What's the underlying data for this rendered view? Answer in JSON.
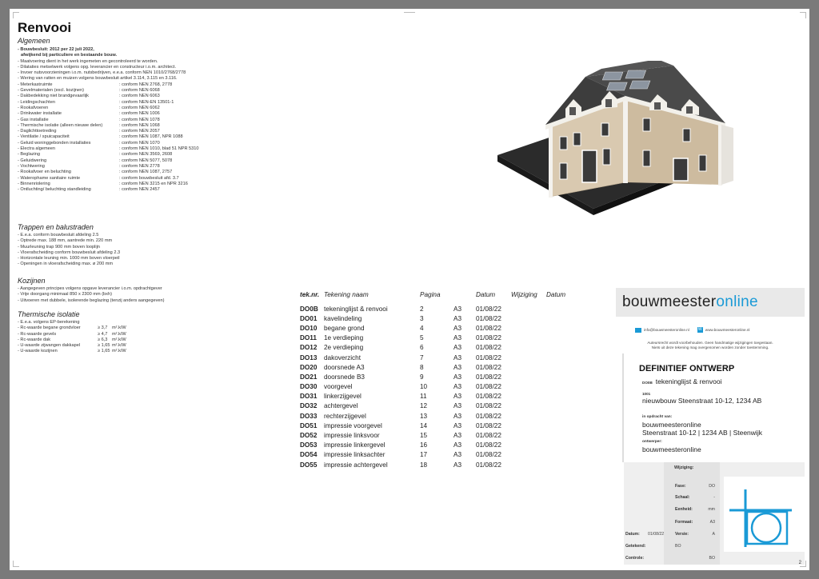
{
  "title": "Renvooi",
  "sections": {
    "algemeen": {
      "heading": "Algemeen",
      "bold_lines": [
        "- Bouwbesluit: 2012 per 22 juli 2022,",
        "afwijkend bij particuliere en bestaande bouw."
      ],
      "lines": [
        "- Maatvoering dient in het werk ingemeten en gecontroleerd te worden.",
        "- Dilataties metselwerk volgens opg. leverancier en constructeur i.o.m. architect.",
        "- Invoer nutsvoorzieningen i.o.m. nutsbedrijven, e.e.a. conform NEN 1010/2768/2778",
        "- Wering van ratten en muizen volgens bouwbesluit artikel 3.114, 3.115 en 3.116."
      ],
      "pairs": [
        [
          "- Meterkastruimte",
          ": conform NEN 2768, 2778"
        ],
        [
          "- Gevelmaterialen (excl. kozijnen)",
          ": conform NEN 6068"
        ],
        [
          "- Dakbedekking niet brandgevaarlijk",
          ": conform NEN 6063"
        ],
        [
          "- Leidingschachten",
          ": conform NEN-EN 13501-1"
        ],
        [
          "- Rookafvoeren",
          ": conform NEN 6062"
        ],
        [
          "- Drinkwater installatie",
          ": conform NEN 1006"
        ],
        [
          "- Gas installatie",
          ": conform NEN 1078"
        ],
        [
          "- Thermische isolatie (alleen nieuwe delen)",
          ": conform NEN 1068"
        ],
        [
          "- Daglichttoetreding",
          ": conform NEN 2057"
        ],
        [
          "- Ventilatie / spuicapaciteit",
          ": conform NEN 1087, NPR 1088"
        ],
        [
          "- Geluid woninggebonden installaties",
          ": conform NEN 1070"
        ],
        [
          "- Electra algemeen",
          ": conform NEN 1010, blad 51 NPR 5310"
        ],
        [
          "- Beglazing",
          ": conform NEN 3569, 2608"
        ],
        [
          "- Geluidwering",
          ": conform NEN 5077, 5078"
        ],
        [
          "- Vochtwering",
          ": conform NEN 2778"
        ],
        [
          "- Rookafvoer en beluchting",
          ": conform NEN 1087, 2757"
        ],
        [
          "- Waterophame sanitaire ruimte",
          ": conform bouwbesluit afd. 3.7"
        ],
        [
          "- Binnenriolering",
          ": conform NEN 3215 en NPR 3216"
        ],
        [
          "- Ontluchting/ beluchting standleiding",
          ": conform NEN 2457"
        ]
      ]
    },
    "trappen": {
      "heading": "Trappen en balustraden",
      "lines": [
        "- E.e.a. conform bouwbesluit afdeling 2.5",
        "- Optrede max. 188 mm, aantrede min. 220 mm",
        "- Muurleuning trap 900 mm boven looplijn",
        "- Vloerafscheiding conform bouwbesluit afdeling 2.3",
        "- Horizontale leuning min. 1000 mm boven vloerpeil",
        "- Openingen in vloerafscheiding max. ø 200 mm"
      ]
    },
    "kozijnen": {
      "heading": "Kozijnen",
      "lines": [
        "- Aangegeven principes volgens opgave leverancier i.o.m. opdrachtgever",
        "- Vrije doorgang minimaal 850 x 2300 mm (bxh)",
        "- Uitvoeren met dubbele, isolerende beglazing (tenzij anders aangegeven)"
      ]
    },
    "isolatie": {
      "heading": "Thermische isolatie",
      "line": "- E.e.a. volgens EP-berekening",
      "rows": [
        [
          "- Rc-waarde begane grondvloer",
          "≥ 3,7",
          "m².k/W"
        ],
        [
          "- Rc-waarde gevels",
          "≥ 4,7",
          "m².k/W"
        ],
        [
          "- Rc-waarde dak",
          "≥ 6,3",
          "m².k/W"
        ],
        [
          "- U-waarde zijwangen dakkapel",
          "≥ 1,65",
          "m².k/W"
        ],
        [
          "- U-waarde kozijnen",
          "≥ 1,65",
          "m².k/W"
        ]
      ]
    }
  },
  "drawing_list": {
    "headers": [
      "tek.nr.",
      "Tekening naam",
      "Pagina",
      "Datum",
      "Wijziging",
      "Datum"
    ],
    "rows": [
      [
        "DO0B",
        "tekeninglijst & renvooi",
        "2",
        "A3",
        "01/08/22"
      ],
      [
        "DO01",
        "kavelindeling",
        "3",
        "A3",
        "01/08/22"
      ],
      [
        "DO10",
        "begane grond",
        "4",
        "A3",
        "01/08/22"
      ],
      [
        "DO11",
        "1e verdieping",
        "5",
        "A3",
        "01/08/22"
      ],
      [
        "DO12",
        "2e verdieping",
        "6",
        "A3",
        "01/08/22"
      ],
      [
        "DO13",
        "dakoverzicht",
        "7",
        "A3",
        "01/08/22"
      ],
      [
        "DO20",
        "doorsnede A3",
        "8",
        "A3",
        "01/08/22"
      ],
      [
        "DO21",
        "doorsnede B3",
        "9",
        "A3",
        "01/08/22"
      ],
      [
        "DO30",
        "voorgevel",
        "10",
        "A3",
        "01/08/22"
      ],
      [
        "DO31",
        "linkerzijgevel",
        "11",
        "A3",
        "01/08/22"
      ],
      [
        "DO32",
        "achtergevel",
        "12",
        "A3",
        "01/08/22"
      ],
      [
        "DO33",
        "rechterzijgevel",
        "13",
        "A3",
        "01/08/22"
      ],
      [
        "DO51",
        "impressie voorgevel",
        "14",
        "A3",
        "01/08/22"
      ],
      [
        "DO52",
        "impressie linksvoor",
        "15",
        "A3",
        "01/08/22"
      ],
      [
        "DO53",
        "impressie linkergevel",
        "16",
        "A3",
        "01/08/22"
      ],
      [
        "DO54",
        "impressie linksachter",
        "17",
        "A3",
        "01/08/22"
      ],
      [
        "DO55",
        "impressie achtergevel",
        "18",
        "A3",
        "01/08/22"
      ]
    ]
  },
  "titleblock": {
    "brand_part1": "bouwmeester",
    "brand_part2": "online",
    "email": "info@bouwmeesteronline.nl",
    "website": "www.bouwmeesteronline.nl",
    "copyright_1": "Auteursrecht wordt voorbehouden. Geen handmatige wijzigingen toegestaan.",
    "copyright_2": "Niets uit deze tekening mag overgenomen worden zonder toestemming.",
    "phase_title": "DEFINITIEF ONTWERP",
    "sheet_code": "DO0B",
    "sheet_name": "tekeninglijst & renvooi",
    "project_no": "1001",
    "project_name": "nieuwbouw Steenstraat 10-12, 1234 AB",
    "client_label": "in opdracht van:",
    "client_name": "bouwmeesteronline",
    "client_address": "Steenstraat 10-12 | 1234 AB | Steenwijk",
    "designer_label": "ontwerper:",
    "designer_name": "bouwmeesteronline",
    "wijziging_label": "Wijziging:",
    "fase_label": "Fase:",
    "fase_value": "DO",
    "schaal_label": "Schaal:",
    "schaal_value": "-",
    "eenheid_label": "Eenheid:",
    "eenheid_value": "mm",
    "formaat_label": "Formaat:",
    "formaat_value": "A3",
    "datum_label": "Datum:",
    "datum_value": "01/08/22",
    "versie_label": "Versie:",
    "versie_value": "A",
    "getekend_label": "Getekend:",
    "getekend_value": "BO",
    "controle_label": "Controle:",
    "controle_value": "BO",
    "page_number": "2"
  },
  "colors": {
    "accent": "#1a9ad6",
    "roof": "#3d3d3d",
    "wall": "#d9c9b0",
    "base": "#2b2b2b"
  }
}
